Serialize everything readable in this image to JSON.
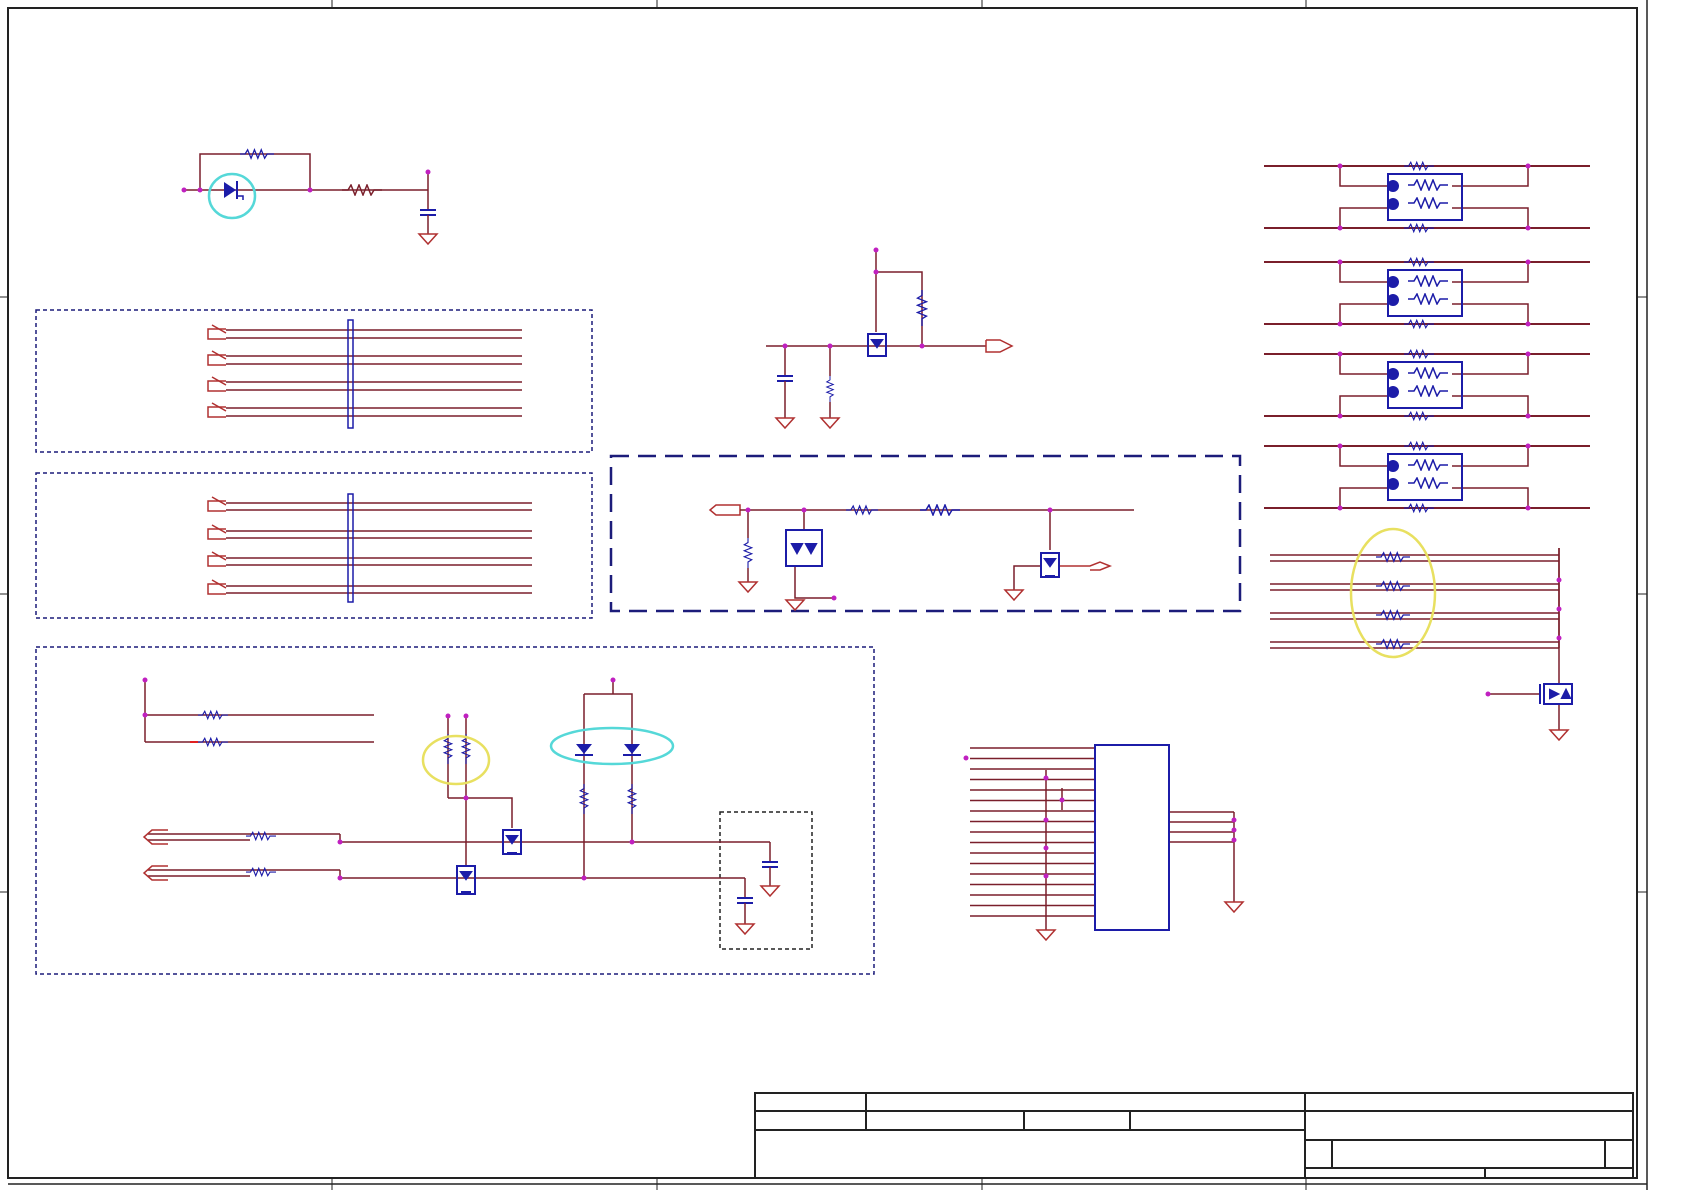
{
  "sheet": {
    "colors": {
      "wire": "#7a1f2b",
      "part": "#1c1ca8",
      "frame": "#222222",
      "dash": "#1c1c7a",
      "node": "#c020c0",
      "highlight_cyan": "#55d8d8",
      "highlight_yellow": "#e8e060",
      "ground": "#b03030"
    },
    "title_block": {
      "title": "",
      "company": "",
      "size": "",
      "document_number": "",
      "rev": "",
      "date": "",
      "sheet": ""
    }
  }
}
